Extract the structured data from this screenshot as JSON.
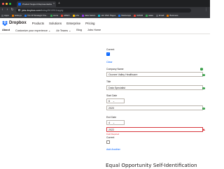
{
  "browser": {
    "tab_title": "Product Support Representative",
    "url_host": "jobs.dropbox.com",
    "url_path": "/listing/5615911/apply",
    "bookmarks": [
      {
        "label": "Apps",
        "color": "#5f6368"
      },
      {
        "label": "wokeye",
        "color": "#e37400"
      },
      {
        "label": "Tim W Strategic Fra...",
        "color": "#1a73e8"
      },
      {
        "label": "icons",
        "color": "#34a853"
      },
      {
        "label": "ADEO",
        "color": "#ea4335"
      },
      {
        "label": "jobs",
        "color": "#fbbc04"
      },
      {
        "label": "data basics",
        "color": "#9334e6"
      },
      {
        "label": "Hot Web Pages",
        "color": "#12b5cb"
      },
      {
        "label": "Medscape",
        "color": "#1a73e8"
      },
      {
        "label": "GMAR",
        "color": "#ea4335"
      },
      {
        "label": "aaaa",
        "color": "#34a853"
      },
      {
        "label": "Email",
        "color": "#5f6368"
      },
      {
        "label": "Business",
        "color": "#e37400"
      }
    ]
  },
  "site": {
    "logo_text": "Dropbox",
    "primary_nav": [
      "Products",
      "Solutions",
      "Enterprise",
      "Pricing"
    ],
    "sub_nav": [
      "About",
      "Customize your experience ⌄",
      "Air Teams ⌄",
      "Blog",
      "Jobs Home"
    ]
  },
  "form": {
    "current_label_top": "Current",
    "clear_link": "Clear",
    "company_label": "Company Name",
    "company_value": "Oconee Valley Healthcare",
    "title_label": "Title",
    "title_value": "Data Specialist",
    "start_label": "Start Date",
    "start_month": "6",
    "start_year": "2020",
    "end_label": "End Date",
    "end_month": "4",
    "end_year": "2022",
    "end_error": "Field Required",
    "current_label_bottom": "Current",
    "add_another_link": "Add Another"
  },
  "section": {
    "title": "Equal Opportunity Self-Identification"
  },
  "colors": {
    "accent": "#0061fe",
    "success": "#2e9a3f",
    "error": "#d8373d"
  }
}
